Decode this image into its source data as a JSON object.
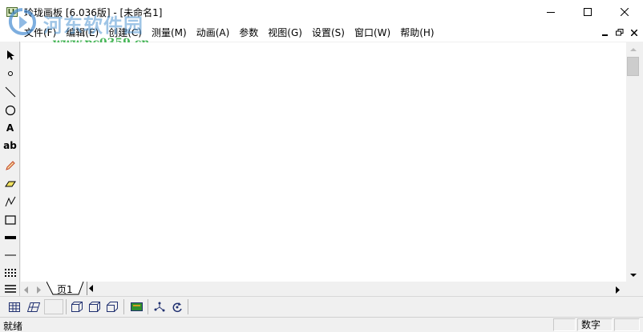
{
  "window": {
    "title": "玲珑画板 [6.036版] - [未命名1]",
    "icon_name": "app-icon",
    "icon_text": "LL"
  },
  "watermark": {
    "text": "河东软件园",
    "url": "www.pc0359.cn"
  },
  "menu": [
    {
      "label": "文件(F)"
    },
    {
      "label": "编辑(E)"
    },
    {
      "label": "创建(C)"
    },
    {
      "label": "测量(M)"
    },
    {
      "label": "动画(A)"
    },
    {
      "label": "参数"
    },
    {
      "label": "视图(G)"
    },
    {
      "label": "设置(S)"
    },
    {
      "label": "窗口(W)"
    },
    {
      "label": "帮助(H)"
    }
  ],
  "left_tools": [
    {
      "name": "select-arrow-icon"
    },
    {
      "name": "point-icon"
    },
    {
      "name": "line-icon"
    },
    {
      "name": "circle-icon"
    },
    {
      "name": "text-a-icon",
      "text": "A"
    },
    {
      "name": "text-ab-icon",
      "text": "ab"
    },
    {
      "name": "pencil-icon"
    },
    {
      "name": "eraser-icon"
    },
    {
      "name": "polyline-icon"
    },
    {
      "name": "rectangle-icon"
    },
    {
      "name": "thick-line-icon"
    },
    {
      "name": "thin-line-icon"
    },
    {
      "name": "dotted-grid-icon"
    },
    {
      "name": "lines-icon"
    }
  ],
  "tabs": {
    "page1": "页1"
  },
  "status": {
    "text": "就绪",
    "mode": "数字"
  },
  "colors": {
    "window_bg": "#f0f0f0",
    "canvas_bg": "#ffffff",
    "watermark_blue": "#5096d2",
    "watermark_green": "#28aa3c"
  }
}
